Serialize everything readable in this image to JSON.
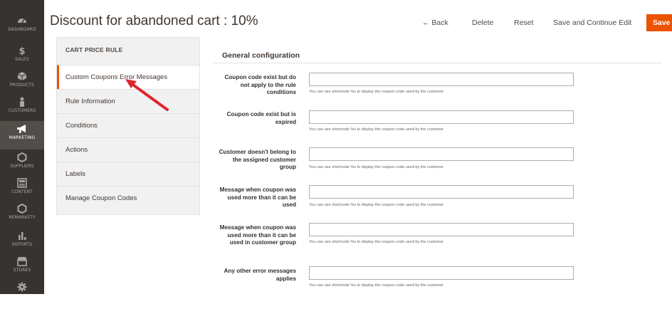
{
  "sidebar": {
    "items": [
      {
        "label": "DASHBOARD",
        "icon": "dashboard-icon"
      },
      {
        "label": "SALES",
        "icon": "dollar-icon"
      },
      {
        "label": "PRODUCTS",
        "icon": "cube-icon"
      },
      {
        "label": "CUSTOMERS",
        "icon": "person-icon"
      },
      {
        "label": "MARKETING",
        "icon": "megaphone-icon",
        "active": true
      },
      {
        "label": "SUPPLIERS",
        "icon": "hexagon-icon"
      },
      {
        "label": "CONTENT",
        "icon": "layout-icon"
      },
      {
        "label": "REMARKETY",
        "icon": "hexagon-icon"
      },
      {
        "label": "REPORTS",
        "icon": "bar-chart-icon"
      },
      {
        "label": "STORES",
        "icon": "store-icon"
      },
      {
        "label": "",
        "icon": "gear-icon"
      }
    ]
  },
  "header": {
    "title": "Discount for abandoned cart : 10%",
    "back_label": "← Back",
    "delete_label": "Delete",
    "reset_label": "Reset",
    "save_continue_label": "Save and Continue Edit",
    "save_label": "Save",
    "save_color": "#eb5202"
  },
  "tabs": {
    "title": "CART PRICE RULE",
    "items": [
      {
        "label": "Custom Coupons Error Messages",
        "active": true
      },
      {
        "label": "Rule Information"
      },
      {
        "label": "Conditions"
      },
      {
        "label": "Actions"
      },
      {
        "label": "Labels"
      },
      {
        "label": "Manage Coupon Codes"
      }
    ]
  },
  "content": {
    "section_title": "General configuration",
    "fields": [
      {
        "label": "Coupon code exist but do not apply to the rule conditions",
        "value": "",
        "note": "You can use shortcode %s to display the coupon code used by the customer"
      },
      {
        "label": "Coupon code exist but is expired",
        "value": "",
        "note": "You can use shortcode %s to display the coupon code used by the customer"
      },
      {
        "label": "Customer doesn't belong to the assigned customer group",
        "value": "",
        "note": "You can use shortcode %s to display the coupon code used by the customer"
      },
      {
        "label": "Message when coupon was used more than it can be used",
        "value": "",
        "note": "You can use shortcode %s to display the coupon code used by the customer"
      },
      {
        "label": "Message when coupon was used more than it can be used in customer group",
        "value": "",
        "note": "You can use shortcode %s to display the coupon code used by the customer"
      },
      {
        "label": "Any other error messages applies",
        "value": "",
        "note": "You can use shortcode %s to display the coupon code used by the customer"
      }
    ]
  },
  "annotation": {
    "arrow_color": "#e0262b"
  }
}
